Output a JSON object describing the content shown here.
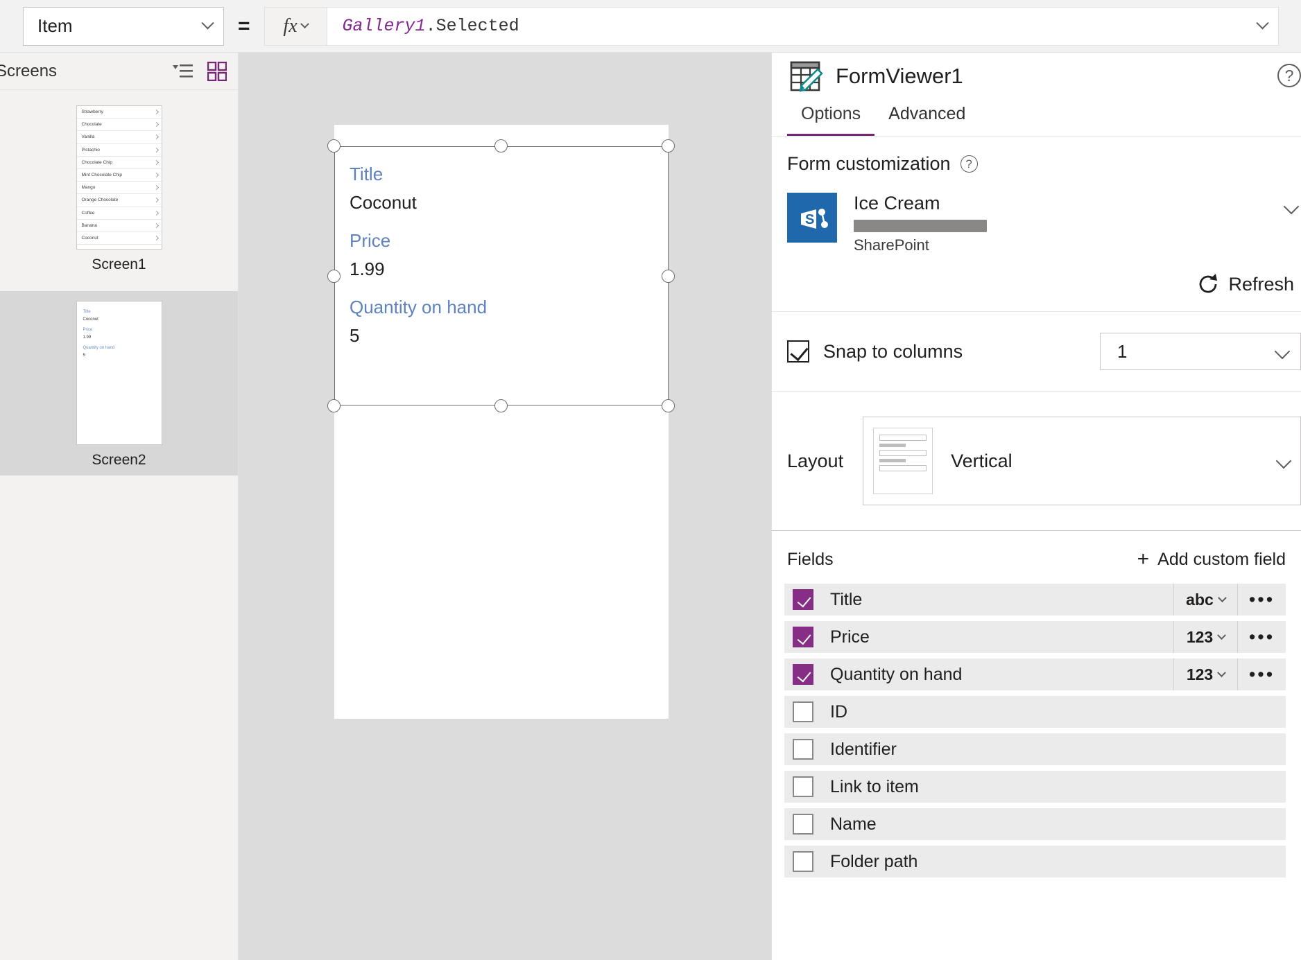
{
  "formula_bar": {
    "property": "Item",
    "equals": "=",
    "fx_label": "fx",
    "formula_object": "Gallery1",
    "formula_rest": ".Selected"
  },
  "left_panel": {
    "header": "Screens",
    "view_icons": [
      "tree-view-icon",
      "thumbnail-view-icon"
    ],
    "screens": [
      {
        "label": "Screen1",
        "selected": false,
        "gallery_items": [
          "Strawberry",
          "Chocolate",
          "Vanilla",
          "Pistachio",
          "Chocolate Chip",
          "Mint Chocolate Chip",
          "Mango",
          "Orange Chocolate",
          "Coffee",
          "Banana",
          "Coconut"
        ]
      },
      {
        "label": "Screen2",
        "selected": true,
        "form_preview": [
          {
            "label": "Title",
            "value": "Coconut"
          },
          {
            "label": "Price",
            "value": "1.99"
          },
          {
            "label": "Quantity on hand",
            "value": "5"
          }
        ]
      }
    ]
  },
  "canvas": {
    "form_fields": [
      {
        "label": "Title",
        "value": "Coconut"
      },
      {
        "label": "Price",
        "value": "1.99"
      },
      {
        "label": "Quantity on hand",
        "value": "5"
      }
    ]
  },
  "right_panel": {
    "title": "FormViewer1",
    "help_glyph": "?",
    "tabs": [
      {
        "label": "Options",
        "active": true
      },
      {
        "label": "Advanced",
        "active": false
      }
    ],
    "form_customization": {
      "heading": "Form customization",
      "help_glyph": "?",
      "datasource_name": "Ice Cream",
      "datasource_account_redacted": "",
      "datasource_type": "SharePoint",
      "refresh_label": "Refresh"
    },
    "snap": {
      "label": "Snap to columns",
      "checked": true,
      "columns_value": "1"
    },
    "layout": {
      "label": "Layout",
      "value": "Vertical"
    },
    "fields": {
      "heading": "Fields",
      "add_label": "Add custom field",
      "add_plus": "+",
      "rows": [
        {
          "name": "Title",
          "checked": true,
          "type": "abc"
        },
        {
          "name": "Price",
          "checked": true,
          "type": "123"
        },
        {
          "name": "Quantity on hand",
          "checked": true,
          "type": "123"
        },
        {
          "name": "ID",
          "checked": false,
          "type": ""
        },
        {
          "name": "Identifier",
          "checked": false,
          "type": ""
        },
        {
          "name": "Link to item",
          "checked": false,
          "type": ""
        },
        {
          "name": "Name",
          "checked": false,
          "type": ""
        },
        {
          "name": "Folder path",
          "checked": false,
          "type": ""
        }
      ],
      "more_glyph": "•••"
    }
  },
  "colors": {
    "accent_purple": "#862d86",
    "tab_underline": "#742774",
    "formula_object": "#812990",
    "field_label_blue": "#5e82c0",
    "sharepoint_blue": "#1e68ab",
    "form_icon_teal": "#0f8a8a"
  }
}
